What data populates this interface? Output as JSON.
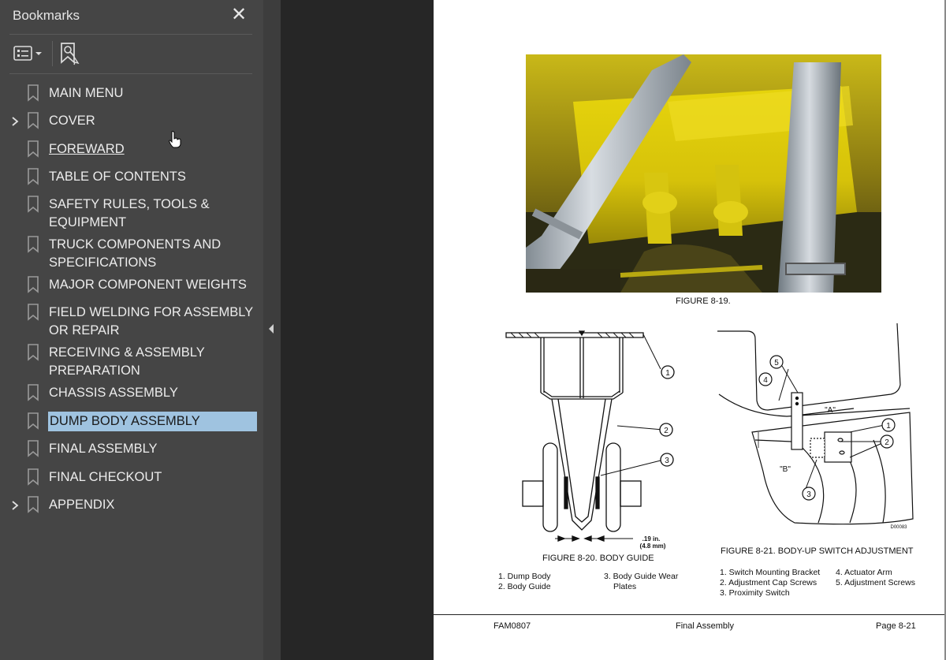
{
  "sidebar": {
    "title": "Bookmarks",
    "close_glyph": "✕",
    "toolbar": {
      "options_icon": "list-options-icon",
      "find_icon": "find-bookmark-icon"
    },
    "items": [
      {
        "label": "MAIN MENU",
        "expandable": false,
        "underline": false,
        "selected": false
      },
      {
        "label": "COVER",
        "expandable": true,
        "underline": false,
        "selected": false
      },
      {
        "label": "FOREWARD",
        "expandable": false,
        "underline": true,
        "selected": false
      },
      {
        "label": "TABLE OF CONTENTS",
        "expandable": false,
        "underline": false,
        "selected": false
      },
      {
        "label": "SAFETY RULES, TOOLS & EQUIPMENT",
        "expandable": false,
        "underline": false,
        "selected": false
      },
      {
        "label": "TRUCK COMPONENTS AND SPECIFICATIONS",
        "expandable": false,
        "underline": false,
        "selected": false
      },
      {
        "label": "MAJOR COMPONENT WEIGHTS",
        "expandable": false,
        "underline": false,
        "selected": false
      },
      {
        "label": "FIELD WELDING FOR ASSEMBLY OR REPAIR",
        "expandable": false,
        "underline": false,
        "selected": false
      },
      {
        "label": "RECEIVING & ASSEMBLY PREPARATION",
        "expandable": false,
        "underline": false,
        "selected": false
      },
      {
        "label": "CHASSIS ASSEMBLY",
        "expandable": false,
        "underline": false,
        "selected": false
      },
      {
        "label": "DUMP BODY ASSEMBLY",
        "expandable": false,
        "underline": false,
        "selected": true
      },
      {
        "label": "FINAL ASSEMBLY",
        "expandable": false,
        "underline": false,
        "selected": false
      },
      {
        "label": "FINAL CHECKOUT",
        "expandable": false,
        "underline": false,
        "selected": false
      },
      {
        "label": "APPENDIX",
        "expandable": true,
        "underline": false,
        "selected": false
      }
    ]
  },
  "document": {
    "fig19_caption": "FIGURE 8-19.",
    "fig20": {
      "caption": "FIGURE 8-20. BODY GUIDE",
      "callouts": [
        "1",
        "2",
        "3"
      ],
      "dimension": ".19 in.",
      "dimension_mm": "(4.8 mm)",
      "legend": [
        "1. Dump Body",
        "2. Body Guide",
        "3. Body Guide Wear",
        "Plates"
      ]
    },
    "fig21": {
      "caption": "FIGURE 8-21. BODY-UP SWITCH ADJUSTMENT",
      "callouts": [
        "5",
        "4",
        "1",
        "2",
        "3"
      ],
      "dim_a": "\"A\"",
      "dim_b": "\"B\"",
      "drawing_no": "D00083",
      "legend": [
        "1. Switch Mounting Bracket",
        "2. Adjustment Cap Screws",
        "3. Proximity Switch",
        "4. Actuator Arm",
        "5. Adjustment Screws"
      ]
    },
    "footer": {
      "left": "FAM0807",
      "center": "Final Assembly",
      "right": "Page 8-21"
    }
  },
  "colors": {
    "sidebar_bg": "#454545",
    "selection": "#9fc3e0",
    "gutter": "#262626",
    "page": "#ffffff",
    "body_yellow": "#d9c80e"
  }
}
